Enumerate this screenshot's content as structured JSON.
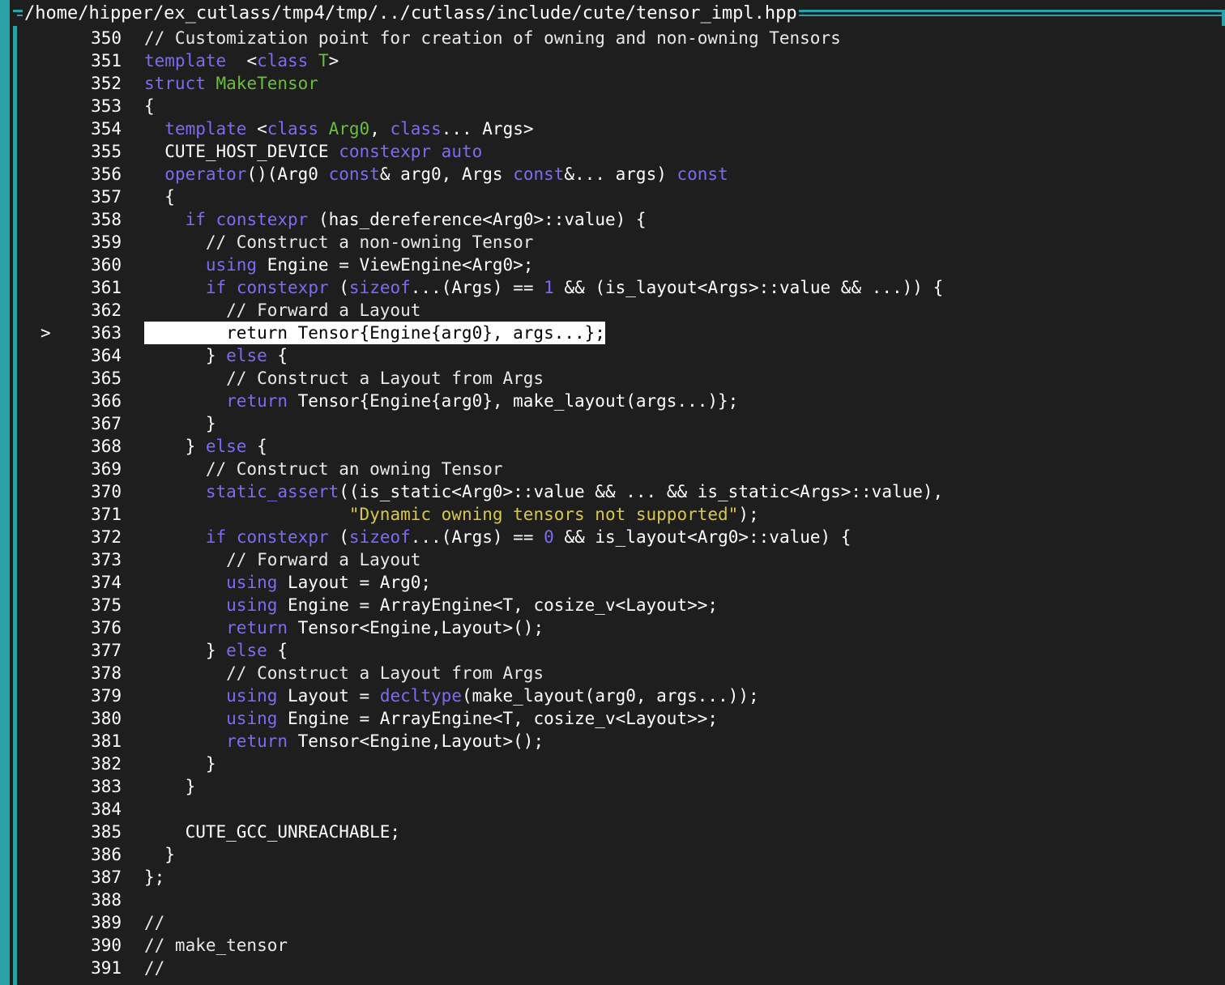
{
  "window": {
    "title": "/home/hipper/ex_cutlass/tmp4/tmp/../cutlass/include/cute/tensor_impl.hpp"
  },
  "colors": {
    "keyword": "#7b6cf6",
    "type": "#6abf3a",
    "string": "#d8c84a",
    "number": "#7b6cf6",
    "text": "#ffffff",
    "background": "#1e1e1e",
    "border": "#2aa1a7",
    "current_line_bg": "#ffffff"
  },
  "editor": {
    "current_line": 363,
    "current_marker": ">",
    "lines": [
      {
        "n": "350",
        "segs": [
          [
            "cm",
            "// Customization point for creation of owning and non-owning Tensors"
          ]
        ]
      },
      {
        "n": "351",
        "segs": [
          [
            "kw",
            "template"
          ],
          [
            "",
            "  <"
          ],
          [
            "kw",
            "class"
          ],
          [
            "",
            " "
          ],
          [
            "ty",
            "T"
          ],
          [
            "",
            ">"
          ]
        ]
      },
      {
        "n": "352",
        "segs": [
          [
            "kw",
            "struct"
          ],
          [
            "",
            " "
          ],
          [
            "ty",
            "MakeTensor"
          ]
        ]
      },
      {
        "n": "353",
        "segs": [
          [
            "",
            "{"
          ]
        ]
      },
      {
        "n": "354",
        "segs": [
          [
            "",
            "  "
          ],
          [
            "kw",
            "template"
          ],
          [
            "",
            " <"
          ],
          [
            "kw",
            "class"
          ],
          [
            "",
            " "
          ],
          [
            "ty",
            "Arg0"
          ],
          [
            "",
            ", "
          ],
          [
            "kw",
            "class"
          ],
          [
            "",
            "... Args>"
          ]
        ]
      },
      {
        "n": "355",
        "segs": [
          [
            "",
            "  CUTE_HOST_DEVICE "
          ],
          [
            "kw",
            "constexpr"
          ],
          [
            "",
            " "
          ],
          [
            "kw",
            "auto"
          ]
        ]
      },
      {
        "n": "356",
        "segs": [
          [
            "",
            "  "
          ],
          [
            "kw",
            "operator"
          ],
          [
            "",
            "()(Arg0 "
          ],
          [
            "kw",
            "const"
          ],
          [
            "",
            "& arg0, Args "
          ],
          [
            "kw",
            "const"
          ],
          [
            "",
            "&... args) "
          ],
          [
            "kw",
            "const"
          ]
        ]
      },
      {
        "n": "357",
        "segs": [
          [
            "",
            "  {"
          ]
        ]
      },
      {
        "n": "358",
        "segs": [
          [
            "",
            "    "
          ],
          [
            "kw",
            "if"
          ],
          [
            "",
            " "
          ],
          [
            "kw",
            "constexpr"
          ],
          [
            "",
            " (has_dereference<Arg0>::value) {"
          ]
        ]
      },
      {
        "n": "359",
        "segs": [
          [
            "cm",
            "      // Construct a non-owning Tensor"
          ]
        ]
      },
      {
        "n": "360",
        "segs": [
          [
            "",
            "      "
          ],
          [
            "kw",
            "using"
          ],
          [
            "",
            " Engine = ViewEngine<Arg0>;"
          ]
        ]
      },
      {
        "n": "361",
        "segs": [
          [
            "",
            "      "
          ],
          [
            "kw",
            "if"
          ],
          [
            "",
            " "
          ],
          [
            "kw",
            "constexpr"
          ],
          [
            "",
            " ("
          ],
          [
            "kw",
            "sizeof"
          ],
          [
            "",
            "...(Args) == "
          ],
          [
            "num",
            "1"
          ],
          [
            "",
            " && (is_layout<Args>::value && ...)) {"
          ]
        ]
      },
      {
        "n": "362",
        "segs": [
          [
            "cm",
            "        // Forward a Layout"
          ]
        ]
      },
      {
        "n": "363",
        "sel": true,
        "segs": [
          [
            "",
            "        return Tensor{Engine{arg0}, args...};"
          ]
        ]
      },
      {
        "n": "364",
        "segs": [
          [
            "",
            "      } "
          ],
          [
            "kw",
            "else"
          ],
          [
            "",
            " {"
          ]
        ]
      },
      {
        "n": "365",
        "segs": [
          [
            "cm",
            "        // Construct a Layout from Args"
          ]
        ]
      },
      {
        "n": "366",
        "segs": [
          [
            "",
            "        "
          ],
          [
            "kw",
            "return"
          ],
          [
            "",
            " Tensor{Engine{arg0}, make_layout(args...)};"
          ]
        ]
      },
      {
        "n": "367",
        "segs": [
          [
            "",
            "      }"
          ]
        ]
      },
      {
        "n": "368",
        "segs": [
          [
            "",
            "    } "
          ],
          [
            "kw",
            "else"
          ],
          [
            "",
            " {"
          ]
        ]
      },
      {
        "n": "369",
        "segs": [
          [
            "cm",
            "      // Construct an owning Tensor"
          ]
        ]
      },
      {
        "n": "370",
        "segs": [
          [
            "",
            "      "
          ],
          [
            "kw",
            "static_assert"
          ],
          [
            "",
            "((is_static<Arg0>::value && ... && is_static<Args>::value),"
          ]
        ]
      },
      {
        "n": "371",
        "segs": [
          [
            "",
            "                    "
          ],
          [
            "str",
            "\"Dynamic owning tensors not supported\""
          ],
          [
            "",
            ");"
          ]
        ]
      },
      {
        "n": "372",
        "segs": [
          [
            "",
            "      "
          ],
          [
            "kw",
            "if"
          ],
          [
            "",
            " "
          ],
          [
            "kw",
            "constexpr"
          ],
          [
            "",
            " ("
          ],
          [
            "kw",
            "sizeof"
          ],
          [
            "",
            "...(Args) == "
          ],
          [
            "num",
            "0"
          ],
          [
            "",
            " && is_layout<Arg0>::value) {"
          ]
        ]
      },
      {
        "n": "373",
        "segs": [
          [
            "cm",
            "        // Forward a Layout"
          ]
        ]
      },
      {
        "n": "374",
        "segs": [
          [
            "",
            "        "
          ],
          [
            "kw",
            "using"
          ],
          [
            "",
            " Layout = Arg0;"
          ]
        ]
      },
      {
        "n": "375",
        "segs": [
          [
            "",
            "        "
          ],
          [
            "kw",
            "using"
          ],
          [
            "",
            " Engine = ArrayEngine<T, cosize_v<Layout>>;"
          ]
        ]
      },
      {
        "n": "376",
        "segs": [
          [
            "",
            "        "
          ],
          [
            "kw",
            "return"
          ],
          [
            "",
            " Tensor<Engine,Layout>();"
          ]
        ]
      },
      {
        "n": "377",
        "segs": [
          [
            "",
            "      } "
          ],
          [
            "kw",
            "else"
          ],
          [
            "",
            " {"
          ]
        ]
      },
      {
        "n": "378",
        "segs": [
          [
            "cm",
            "        // Construct a Layout from Args"
          ]
        ]
      },
      {
        "n": "379",
        "segs": [
          [
            "",
            "        "
          ],
          [
            "kw",
            "using"
          ],
          [
            "",
            " Layout = "
          ],
          [
            "kw",
            "decltype"
          ],
          [
            "",
            "(make_layout(arg0, args...));"
          ]
        ]
      },
      {
        "n": "380",
        "segs": [
          [
            "",
            "        "
          ],
          [
            "kw",
            "using"
          ],
          [
            "",
            " Engine = ArrayEngine<T, cosize_v<Layout>>;"
          ]
        ]
      },
      {
        "n": "381",
        "segs": [
          [
            "",
            "        "
          ],
          [
            "kw",
            "return"
          ],
          [
            "",
            " Tensor<Engine,Layout>();"
          ]
        ]
      },
      {
        "n": "382",
        "segs": [
          [
            "",
            "      }"
          ]
        ]
      },
      {
        "n": "383",
        "segs": [
          [
            "",
            "    }"
          ]
        ]
      },
      {
        "n": "384",
        "segs": [
          [
            "",
            ""
          ]
        ]
      },
      {
        "n": "385",
        "segs": [
          [
            "",
            "    CUTE_GCC_UNREACHABLE;"
          ]
        ]
      },
      {
        "n": "386",
        "segs": [
          [
            "",
            "  }"
          ]
        ]
      },
      {
        "n": "387",
        "segs": [
          [
            "",
            "};"
          ]
        ]
      },
      {
        "n": "388",
        "segs": [
          [
            "",
            ""
          ]
        ]
      },
      {
        "n": "389",
        "segs": [
          [
            "cm",
            "//"
          ]
        ]
      },
      {
        "n": "390",
        "segs": [
          [
            "cm",
            "// make_tensor"
          ]
        ]
      },
      {
        "n": "391",
        "segs": [
          [
            "cm",
            "//"
          ]
        ]
      }
    ]
  }
}
